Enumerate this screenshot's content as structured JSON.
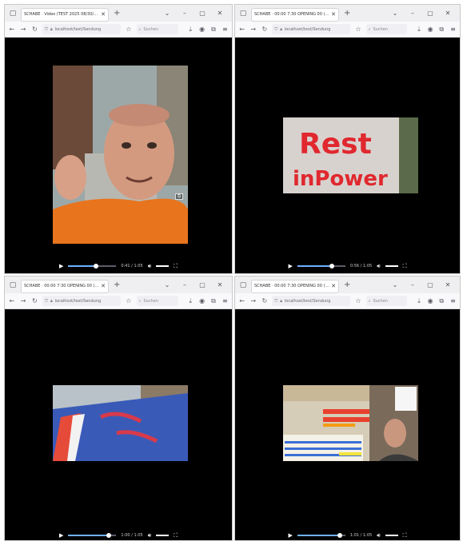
{
  "windows": [
    {
      "tab_title": "SCHABE · Video (TEST 2025 08/30/2021 27)",
      "url_text": "localhost/test/Sendung",
      "search_placeholder": "Suchen",
      "time": "0:41 / 1:05",
      "progress": 0.58,
      "video_desc": "man-orange-shirt"
    },
    {
      "tab_title": "SCHABE · 00:00 7:30 OPENING 00 (17)",
      "url_text": "localhost/test/Sendung",
      "search_placeholder": "Suchen",
      "time": "0:56 / 1:05",
      "progress": 0.72,
      "video_desc": "rest-in-power-sign",
      "sign_text_line1": "Rest",
      "sign_text_line2": "inPower"
    },
    {
      "tab_title": "SCHABE · 00:00 7:30 OPENING 00 (17)",
      "url_text": "localhost/test/Sendung",
      "search_placeholder": "Suchen",
      "time": "1:00 / 1:05",
      "progress": 0.85,
      "video_desc": "blue-barrier"
    },
    {
      "tab_title": "SCHABE · 00:00 7:30 OPENING 00 (17)",
      "url_text": "localhost/test/Sendung",
      "search_placeholder": "Suchen",
      "time": "1:01 / 1:05",
      "progress": 0.88,
      "video_desc": "newspaper-collage"
    }
  ],
  "colors": {
    "accent": "#6fb1ff",
    "video_bg": "#000000",
    "chrome_bg": "#efeff2"
  }
}
